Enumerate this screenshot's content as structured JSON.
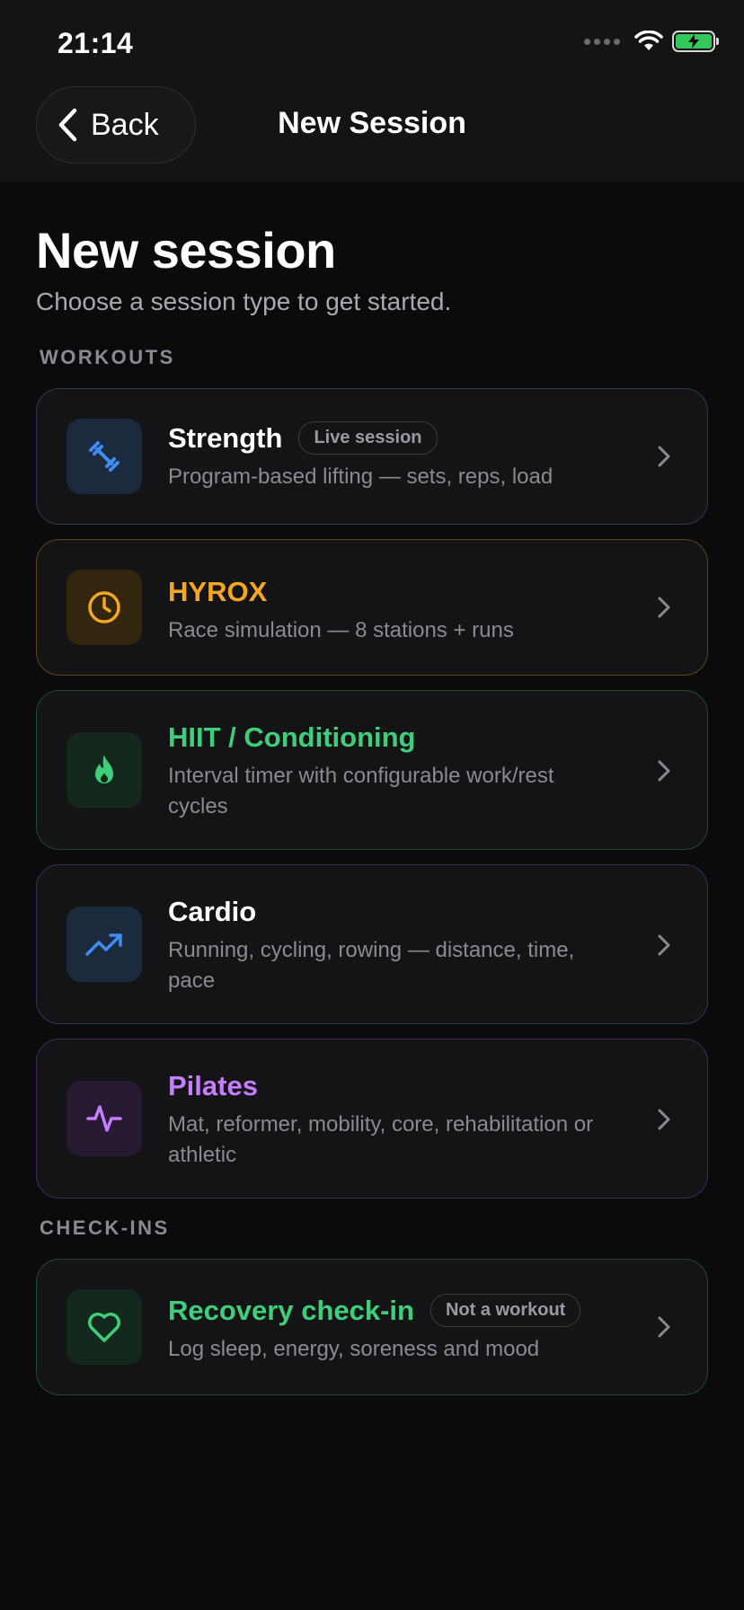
{
  "status_bar": {
    "time": "21:14"
  },
  "nav": {
    "back_label": "Back",
    "title": "New Session"
  },
  "page": {
    "title": "New session",
    "subtitle": "Choose a session type to get started."
  },
  "sections": {
    "workouts_label": "WORKOUTS",
    "checkins_label": "CHECK-INS"
  },
  "cards": {
    "strength": {
      "title": "Strength",
      "badge": "Live session",
      "description": "Program-based lifting — sets, reps, load",
      "icon": "dumbbell-icon",
      "color": "#ffffff",
      "accent": "#3d8ef0"
    },
    "hyrox": {
      "title": "HYROX",
      "description": "Race simulation — 8 stations + runs",
      "icon": "clock-icon",
      "color": "#f5a623"
    },
    "hiit": {
      "title": "HIIT / Conditioning",
      "description": "Interval timer with configurable work/rest cycles",
      "icon": "flame-icon",
      "color": "#3ecf7a"
    },
    "cardio": {
      "title": "Cardio",
      "description": "Running, cycling, rowing — distance, time, pace",
      "icon": "trending-up-icon",
      "color": "#ffffff",
      "accent": "#3d8ef0"
    },
    "pilates": {
      "title": "Pilates",
      "description": "Mat, reformer, mobility, core, rehabilitation or athletic",
      "icon": "pulse-icon",
      "color": "#c77dff"
    },
    "recovery": {
      "title": "Recovery check-in",
      "badge": "Not a workout",
      "description": "Log sleep, energy, soreness and mood",
      "icon": "heart-icon",
      "color": "#3ecf7a"
    }
  }
}
